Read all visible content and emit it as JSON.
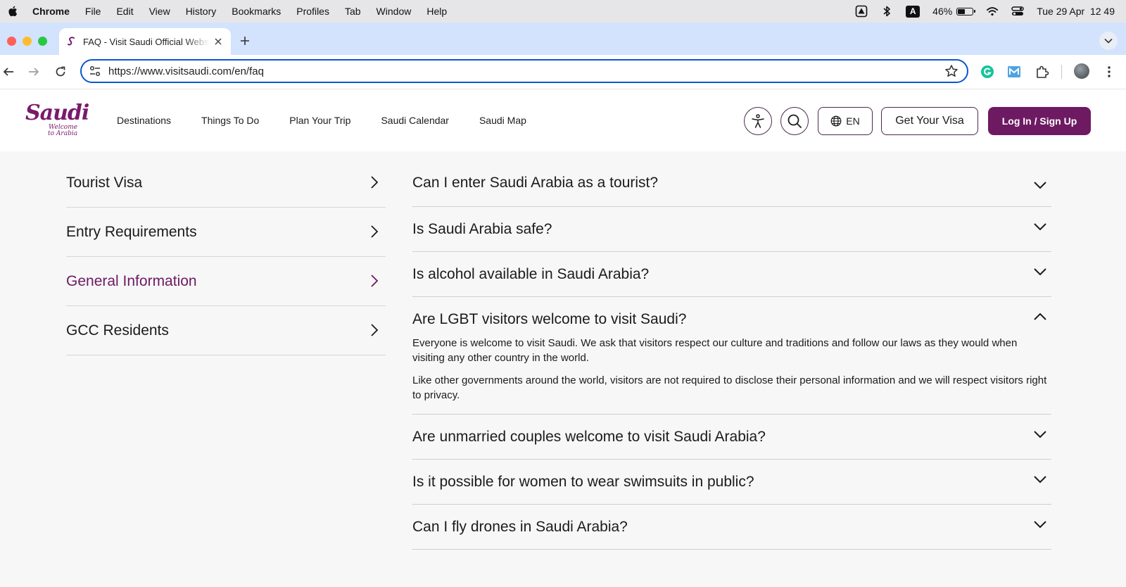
{
  "menubar": {
    "app_name": "Chrome",
    "items": [
      "File",
      "Edit",
      "View",
      "History",
      "Bookmarks",
      "Profiles",
      "Tab",
      "Window",
      "Help"
    ],
    "battery_percent": "46%",
    "battery_level": 0.46,
    "input_badge": "A",
    "datetime": "Tue 29 Apr  12 49"
  },
  "browser": {
    "tab_title": "FAQ - Visit Saudi Official Website",
    "url": "https://www.visitsaudi.com/en/faq",
    "traffic_colors": [
      "#ff5f57",
      "#febc2e",
      "#28c840"
    ]
  },
  "site": {
    "logo": {
      "brand": "Saudi",
      "tagline_1": "Welcome",
      "tagline_2": "to Arabia"
    },
    "nav": [
      "Destinations",
      "Things To Do",
      "Plan Your Trip",
      "Saudi Calendar",
      "Saudi Map"
    ],
    "lang_label": "EN",
    "visa_label": "Get Your Visa",
    "login_label": "Log In / Sign Up",
    "accent_color": "#6d1a63"
  },
  "categories": [
    {
      "label": "Tourist Visa",
      "active": false
    },
    {
      "label": "Entry Requirements",
      "active": false
    },
    {
      "label": "General Information",
      "active": true
    },
    {
      "label": "GCC Residents",
      "active": false
    }
  ],
  "faqs": [
    {
      "question": "Can I enter Saudi Arabia as a tourist?",
      "expanded": false
    },
    {
      "question": "Is Saudi Arabia safe?",
      "expanded": false
    },
    {
      "question": "Is alcohol available in Saudi Arabia?",
      "expanded": false
    },
    {
      "question": "Are LGBT visitors welcome to visit Saudi?",
      "expanded": true,
      "answer": [
        "Everyone is welcome to visit Saudi. We ask that visitors respect our culture and traditions and follow our laws as they would when visiting any other country in the world.",
        "Like other governments around the world, visitors are not required to disclose their personal information and we will respect visitors right to privacy."
      ]
    },
    {
      "question": "Are unmarried couples welcome to visit Saudi Arabia?",
      "expanded": false
    },
    {
      "question": "Is it possible for women to wear swimsuits in public?",
      "expanded": false
    },
    {
      "question": "Can I fly drones in Saudi Arabia?",
      "expanded": false
    }
  ]
}
